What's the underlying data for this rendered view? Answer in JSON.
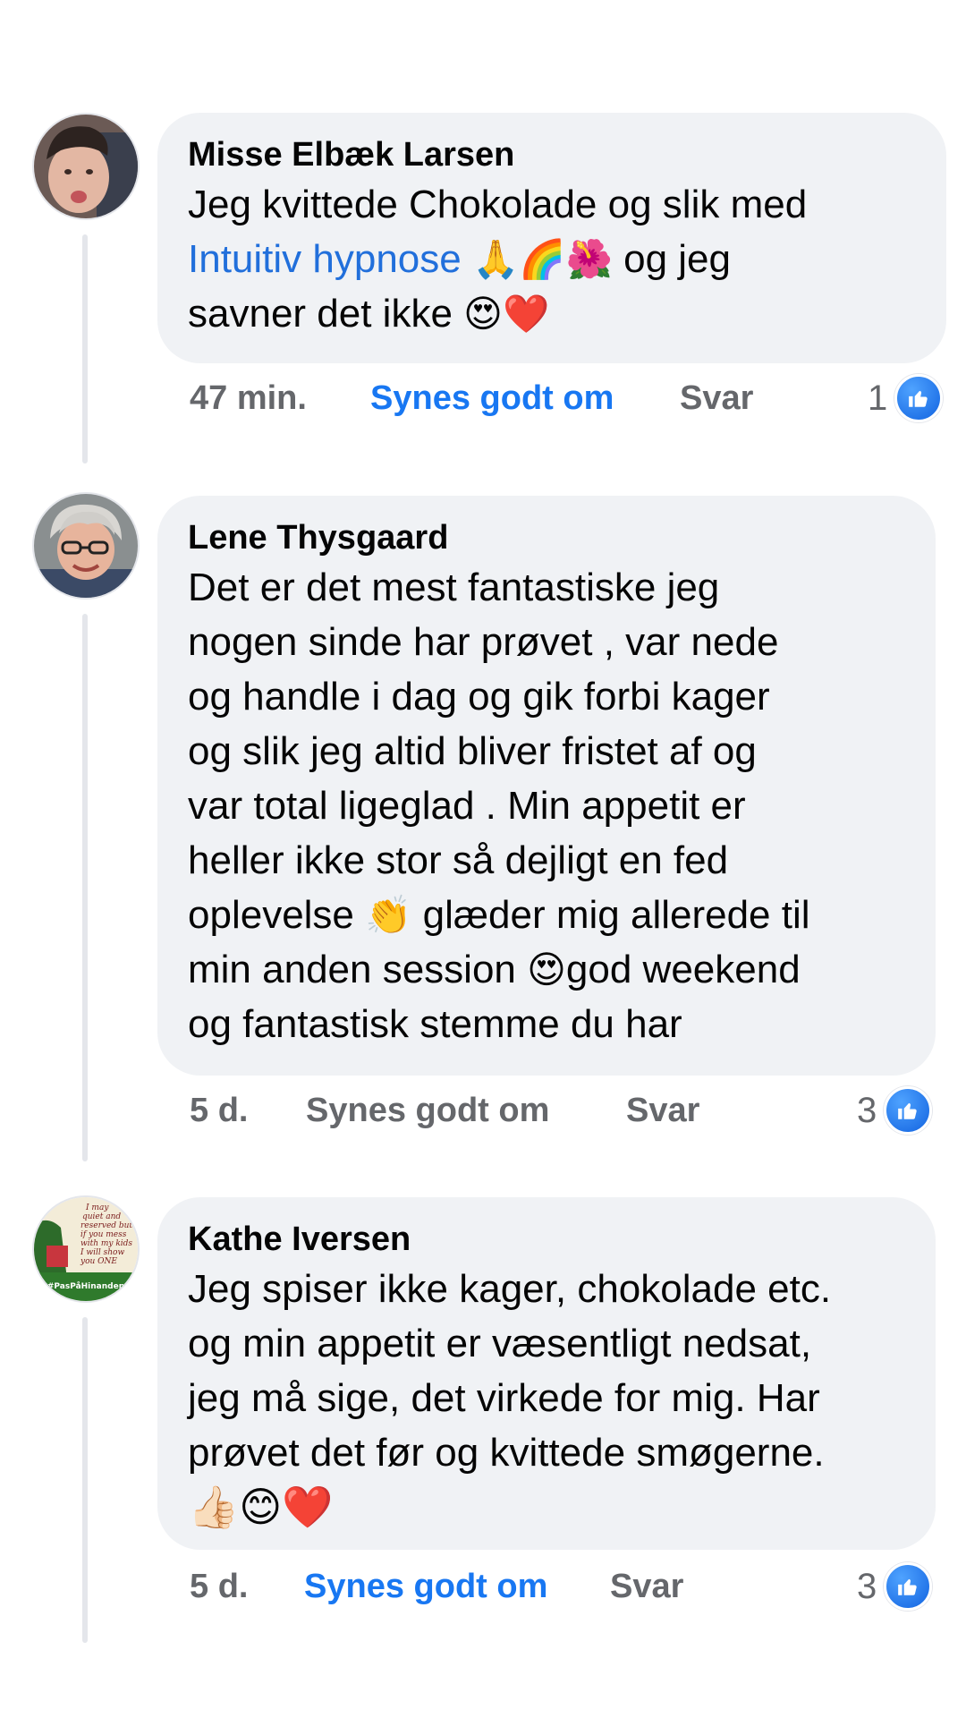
{
  "comments": [
    {
      "author": "Misse Elbæk Larsen",
      "text_1": "Jeg kvittede Chokolade og slik med",
      "link": "Intuitiv hypnose",
      "emoji_a": "🙏🌈🌺",
      "text_2": " og jeg",
      "text_3": "savner det ikke ",
      "emoji_b": "😍❤️",
      "time": "47 min.",
      "like_label": "Synes godt om",
      "reply_label": "Svar",
      "like_count": "1",
      "liked": true
    },
    {
      "author": "Lene Thysgaard",
      "lines": [
        "Det er det mest fantastiske jeg",
        "nogen sinde har prøvet , var nede",
        "og handle i dag og gik forbi kager",
        "og slik jeg altid bliver fristet af og",
        "var total ligeglad . Min appetit er",
        "heller ikke stor så dejligt en fed"
      ],
      "line7_a": "oplevelse ",
      "line7_emoji": "👏",
      "line7_b": " glæder mig allerede til",
      "line8_a": "min anden session ",
      "line8_emoji": "😍",
      "line8_b": "god weekend",
      "line9": "og fantastisk stemme du har",
      "time": "5 d.",
      "like_label": "Synes godt om",
      "reply_label": "Svar",
      "like_count": "3",
      "liked": false
    },
    {
      "author": "Kathe Iversen",
      "lines": [
        "Jeg spiser ikke kager, chokolade etc.",
        "og min appetit er væsentligt nedsat,",
        "jeg må sige, det virkede for mig. Har",
        "prøvet det før og kvittede smøgerne."
      ],
      "emoji_line": "👍🏻😊❤️",
      "avatar_text_1": "I may",
      "avatar_text_2": "quiet and",
      "avatar_text_3": "reserved but",
      "avatar_text_4": "if you mess",
      "avatar_text_5": "with my kids",
      "avatar_text_6": "I will show",
      "avatar_text_7": "you ONE",
      "avatar_badge": "#PasPåHinanden",
      "time": "5 d.",
      "like_label": "Synes godt om",
      "reply_label": "Svar",
      "like_count": "3",
      "liked": true
    }
  ],
  "colors": {
    "bubble": "#f0f2f5",
    "accent": "#1877f2",
    "link": "#216fdb",
    "meta": "#65676b"
  },
  "icons": {
    "like_reaction": "thumbs-up-icon"
  }
}
